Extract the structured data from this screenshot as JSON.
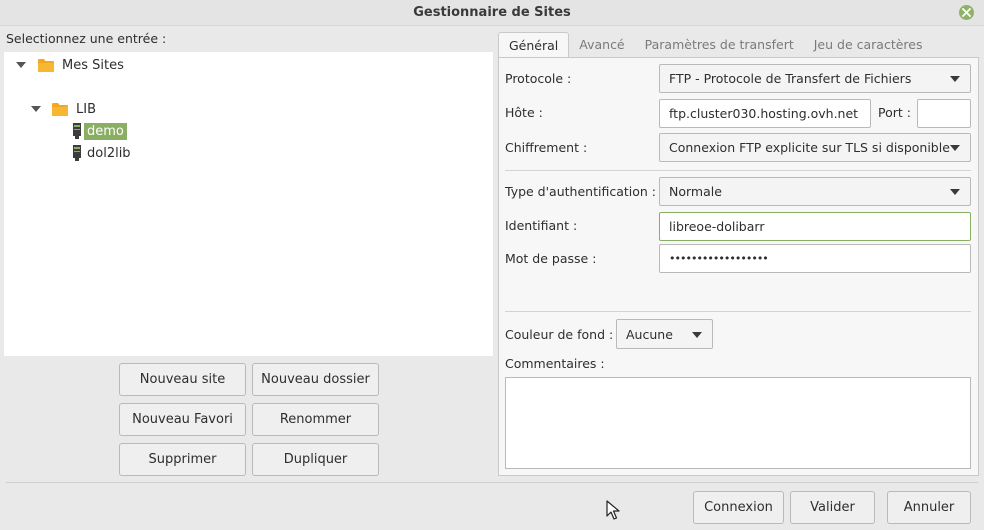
{
  "window": {
    "title": "Gestionnaire de Sites"
  },
  "left": {
    "label": "Selectionnez une entrée :",
    "tree": {
      "root": "Mes Sites",
      "folder": "LIB",
      "items": [
        "demo",
        "dol2lib"
      ],
      "selected": "demo"
    },
    "buttons": {
      "new_site": "Nouveau site",
      "new_folder": "Nouveau dossier",
      "new_bookmark": "Nouveau Favori",
      "rename": "Renommer",
      "delete": "Supprimer",
      "duplicate": "Dupliquer"
    }
  },
  "tabs": [
    "Général",
    "Avancé",
    "Paramètres de transfert",
    "Jeu de caractères"
  ],
  "general": {
    "protocol_label": "Protocole :",
    "protocol_value": "FTP - Protocole de Transfert de Fichiers",
    "host_label": "Hôte :",
    "host_value": "ftp.cluster030.hosting.ovh.net",
    "port_label": "Port :",
    "port_value": "",
    "encryption_label": "Chiffrement :",
    "encryption_value": "Connexion FTP explicite sur TLS si disponible",
    "auth_label": "Type d'authentification :",
    "auth_value": "Normale",
    "user_label": "Identifiant :",
    "user_value": "libreoe-dolibarr",
    "password_label": "Mot de passe :",
    "password_value": "••••••••••••••••••",
    "bgcolor_label": "Couleur de fond :",
    "bgcolor_value": "Aucune",
    "comments_label": "Commentaires :"
  },
  "footer": {
    "connect": "Connexion",
    "ok": "Valider",
    "cancel": "Annuler"
  },
  "colors": {
    "accent": "#8aaf62",
    "folder": "#f5a623"
  }
}
